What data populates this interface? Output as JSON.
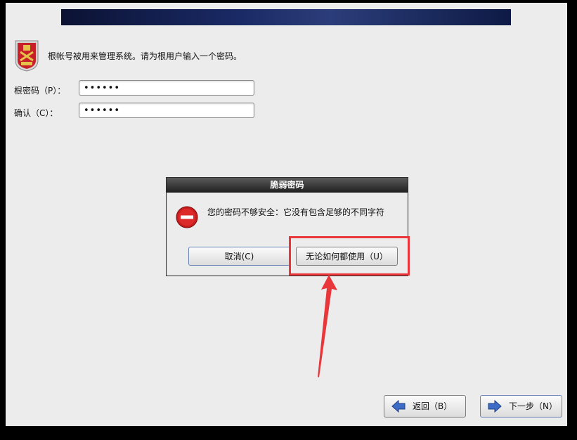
{
  "banner": {},
  "intro": {
    "text": "根帐号被用来管理系统。请为根用户输入一个密码。"
  },
  "form": {
    "root_password_label": "根密码（P）：",
    "root_password_value": "••••••",
    "confirm_label": "确认（C）：",
    "confirm_value": "••••••"
  },
  "dialog": {
    "title": "脆弱密码",
    "message": "您的密码不够安全：它没有包含足够的不同字符",
    "cancel_label": "取消(C)",
    "use_anyway_label": "无论如何都使用（U）"
  },
  "nav": {
    "back_label": "返回（B）",
    "next_label": "下一步（N）"
  },
  "colors": {
    "highlight": "#e8363b",
    "banner": "#1a2a66"
  }
}
